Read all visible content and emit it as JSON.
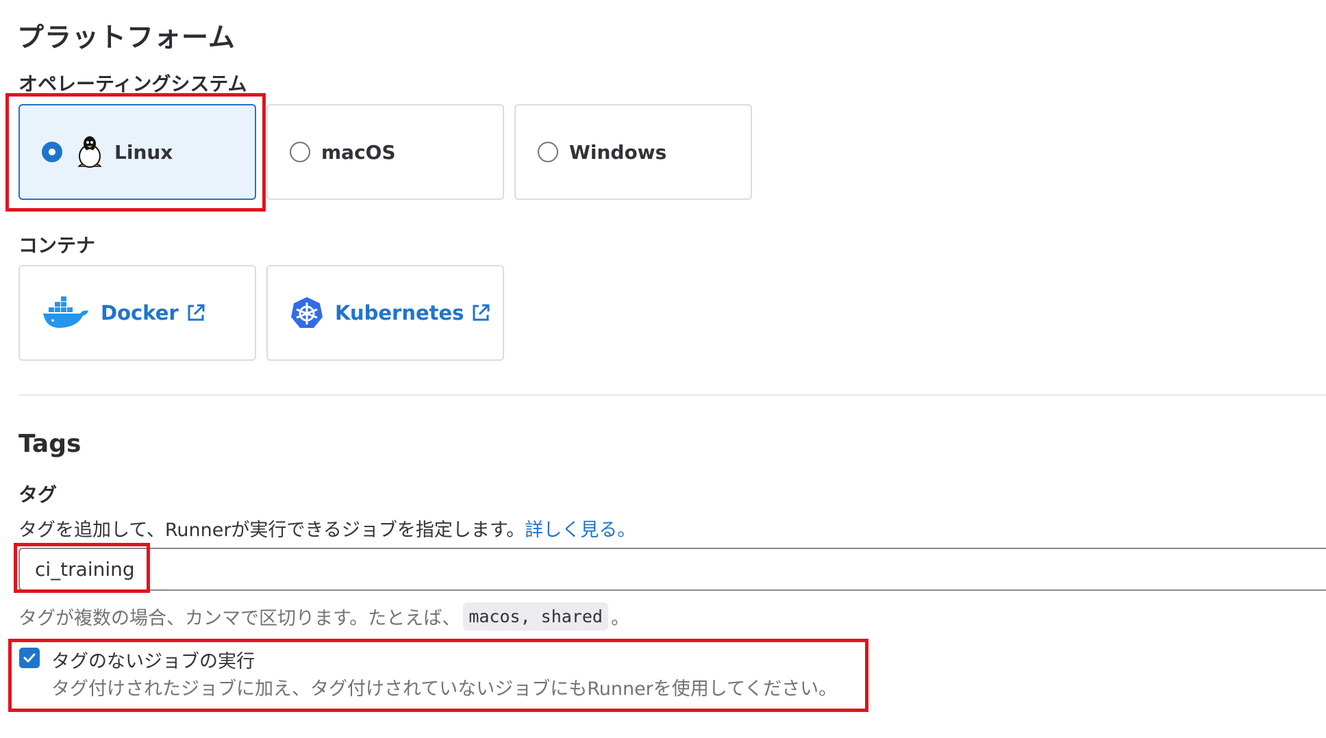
{
  "platform": {
    "heading": "プラットフォーム",
    "os_label": "オペレーティングシステム",
    "os_options": [
      {
        "label": "Linux",
        "selected": true,
        "icon": "tux-penguin-icon"
      },
      {
        "label": "macOS",
        "selected": false
      },
      {
        "label": "Windows",
        "selected": false
      }
    ],
    "container_label": "コンテナ",
    "containers": [
      {
        "label": "Docker",
        "icon": "docker-whale-icon"
      },
      {
        "label": "Kubernetes",
        "icon": "kubernetes-helm-icon"
      }
    ]
  },
  "tags": {
    "heading": "Tags",
    "label": "タグ",
    "description": "タグを追加して、Runnerが実行できるジョブを指定します。",
    "learn_more": "詳しく見る。",
    "input_value": "ci_training",
    "help_prefix": "タグが複数の場合、カンマで区切ります。たとえば、",
    "help_example": "macos, shared",
    "help_suffix": "。",
    "untagged_checkbox": {
      "checked": true,
      "label": "タグのないジョブの実行",
      "help": "タグ付けされたジョブに加え、タグ付けされていないジョブにもRunnerを使用してください。"
    }
  },
  "colors": {
    "accent": "#1f75cb",
    "highlight": "#e0141e",
    "selected_bg": "#e9f3fc",
    "docker_blue": "#2496ed",
    "kubernetes_blue": "#326ce5"
  }
}
